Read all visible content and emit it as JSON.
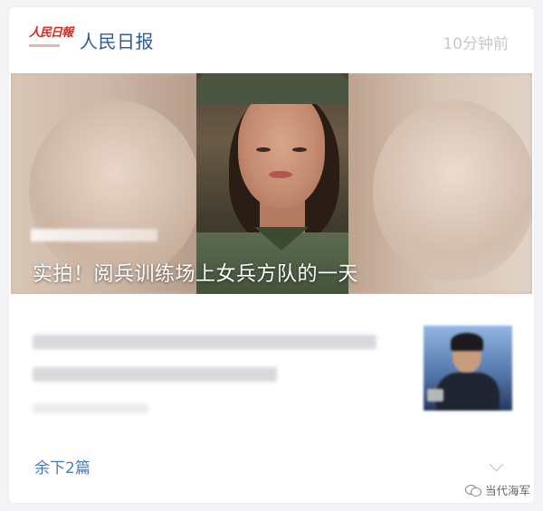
{
  "header": {
    "logo_text": "人民日報",
    "source_name": "人民日报",
    "time": "10分钟前"
  },
  "hero": {
    "title": "实拍！阅兵训练场上女兵方队的一天"
  },
  "more_link": "余下2篇",
  "watermark": "当代海军",
  "colors": {
    "accent": "#2f5c98",
    "logo_red": "#d42a1e",
    "link_blue": "#4e7ab3"
  },
  "icons": [
    "chevron-down-icon",
    "wechat-icon"
  ]
}
